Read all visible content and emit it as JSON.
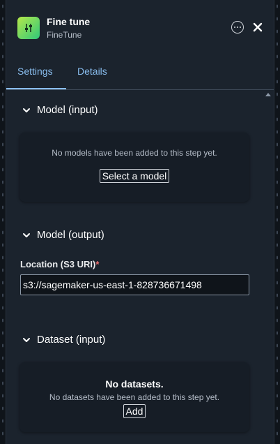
{
  "header": {
    "title": "Fine tune",
    "subtitle": "FineTune"
  },
  "tabs": [
    {
      "label": "Settings",
      "active": true
    },
    {
      "label": "Details",
      "active": false
    }
  ],
  "sections": {
    "model_input": {
      "title": "Model (input)",
      "empty_text": "No models have been added to this step yet.",
      "action_label": "Select a model"
    },
    "model_output": {
      "title": "Model (output)",
      "location_label": "Location (S3 URI)",
      "required_marker": "*",
      "location_value": "s3://sagemaker-us-east-1-828736671498"
    },
    "dataset_input": {
      "title": "Dataset (input)",
      "empty_heading": "No datasets.",
      "empty_text": "No datasets have been added to this step yet.",
      "action_label": "Add"
    }
  },
  "colors": {
    "accent": "#89bdee",
    "panel": "#1b232d",
    "card": "#161d26",
    "required": "#eb6f6f"
  }
}
